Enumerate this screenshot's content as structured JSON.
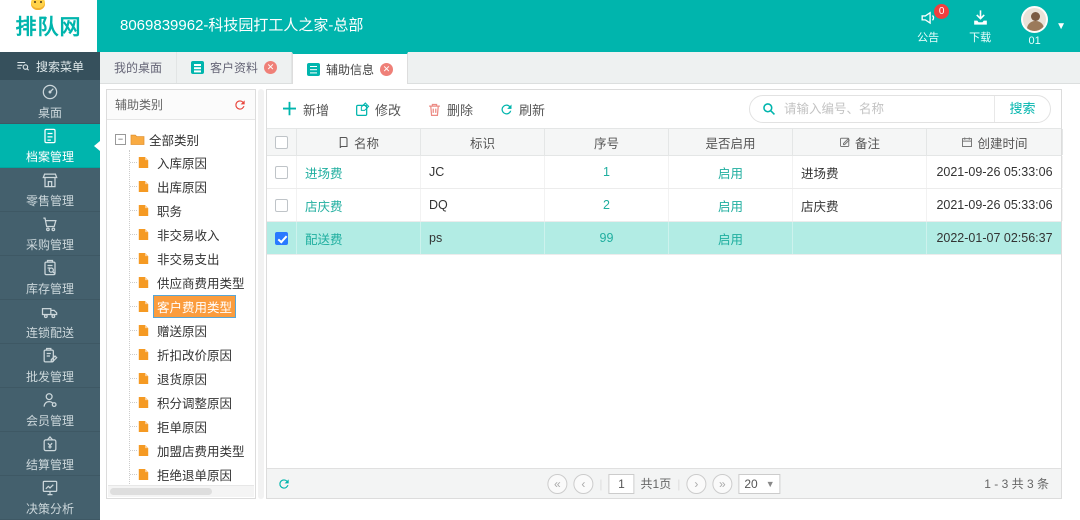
{
  "colors": {
    "teal": "#00b5ad",
    "sidebar": "#44606d",
    "sidebar-dark": "#36505c",
    "selrow": "#b2ece4",
    "tree-sel": "#fb9c3d",
    "danger": "#e8453c",
    "link": "#1fae9f",
    "badge": "#f03e3e",
    "cbblue": "#2979ff"
  },
  "topbar": {
    "logo": "排队网",
    "title": "8069839962-科技园打工人之家-总部",
    "announce_label": "公告",
    "announce_badge": "0",
    "download_label": "下载",
    "avatar_label": "01"
  },
  "sidebar": {
    "search_label": "搜索菜单",
    "items": [
      {
        "label": "桌面"
      },
      {
        "label": "档案管理"
      },
      {
        "label": "零售管理"
      },
      {
        "label": "采购管理"
      },
      {
        "label": "库存管理"
      },
      {
        "label": "连锁配送"
      },
      {
        "label": "批发管理"
      },
      {
        "label": "会员管理"
      },
      {
        "label": "结算管理"
      },
      {
        "label": "决策分析"
      }
    ]
  },
  "tabs": [
    {
      "label": "我的桌面"
    },
    {
      "label": "客户资料"
    },
    {
      "label": "辅助信息"
    }
  ],
  "tree": {
    "header": "辅助类别",
    "root": "全部类别",
    "items": [
      "入库原因",
      "出库原因",
      "职务",
      "非交易收入",
      "非交易支出",
      "供应商费用类型",
      "客户费用类型",
      "赠送原因",
      "折扣改价原因",
      "退货原因",
      "积分调整原因",
      "拒单原因",
      "加盟店费用类型",
      "拒绝退单原因"
    ],
    "selected": "客户费用类型"
  },
  "toolbar": {
    "add": "新增",
    "edit": "修改",
    "delete": "删除",
    "refresh": "刷新",
    "search_placeholder": "请输入编号、名称",
    "search_button": "搜索"
  },
  "table": {
    "columns": [
      "名称",
      "标识",
      "序号",
      "是否启用",
      "备注",
      "创建时间"
    ],
    "rows": [
      {
        "name": "进场费",
        "code": "JC",
        "seq": "1",
        "enabled": "启用",
        "remark": "进场费",
        "created": "2021-09-26 05:33:06",
        "checked": false
      },
      {
        "name": "店庆费",
        "code": "DQ",
        "seq": "2",
        "enabled": "启用",
        "remark": "店庆费",
        "created": "2021-09-26 05:33:06",
        "checked": false
      },
      {
        "name": "配送费",
        "code": "ps",
        "seq": "99",
        "enabled": "启用",
        "remark": "",
        "created": "2022-01-07 02:56:37",
        "checked": true
      }
    ]
  },
  "pagination": {
    "first": "«",
    "prev": "‹",
    "next": "›",
    "last": "»",
    "page": "1",
    "total_pages_label": "共1页",
    "page_size": "20",
    "summary": "1 - 3  共 3 条"
  }
}
